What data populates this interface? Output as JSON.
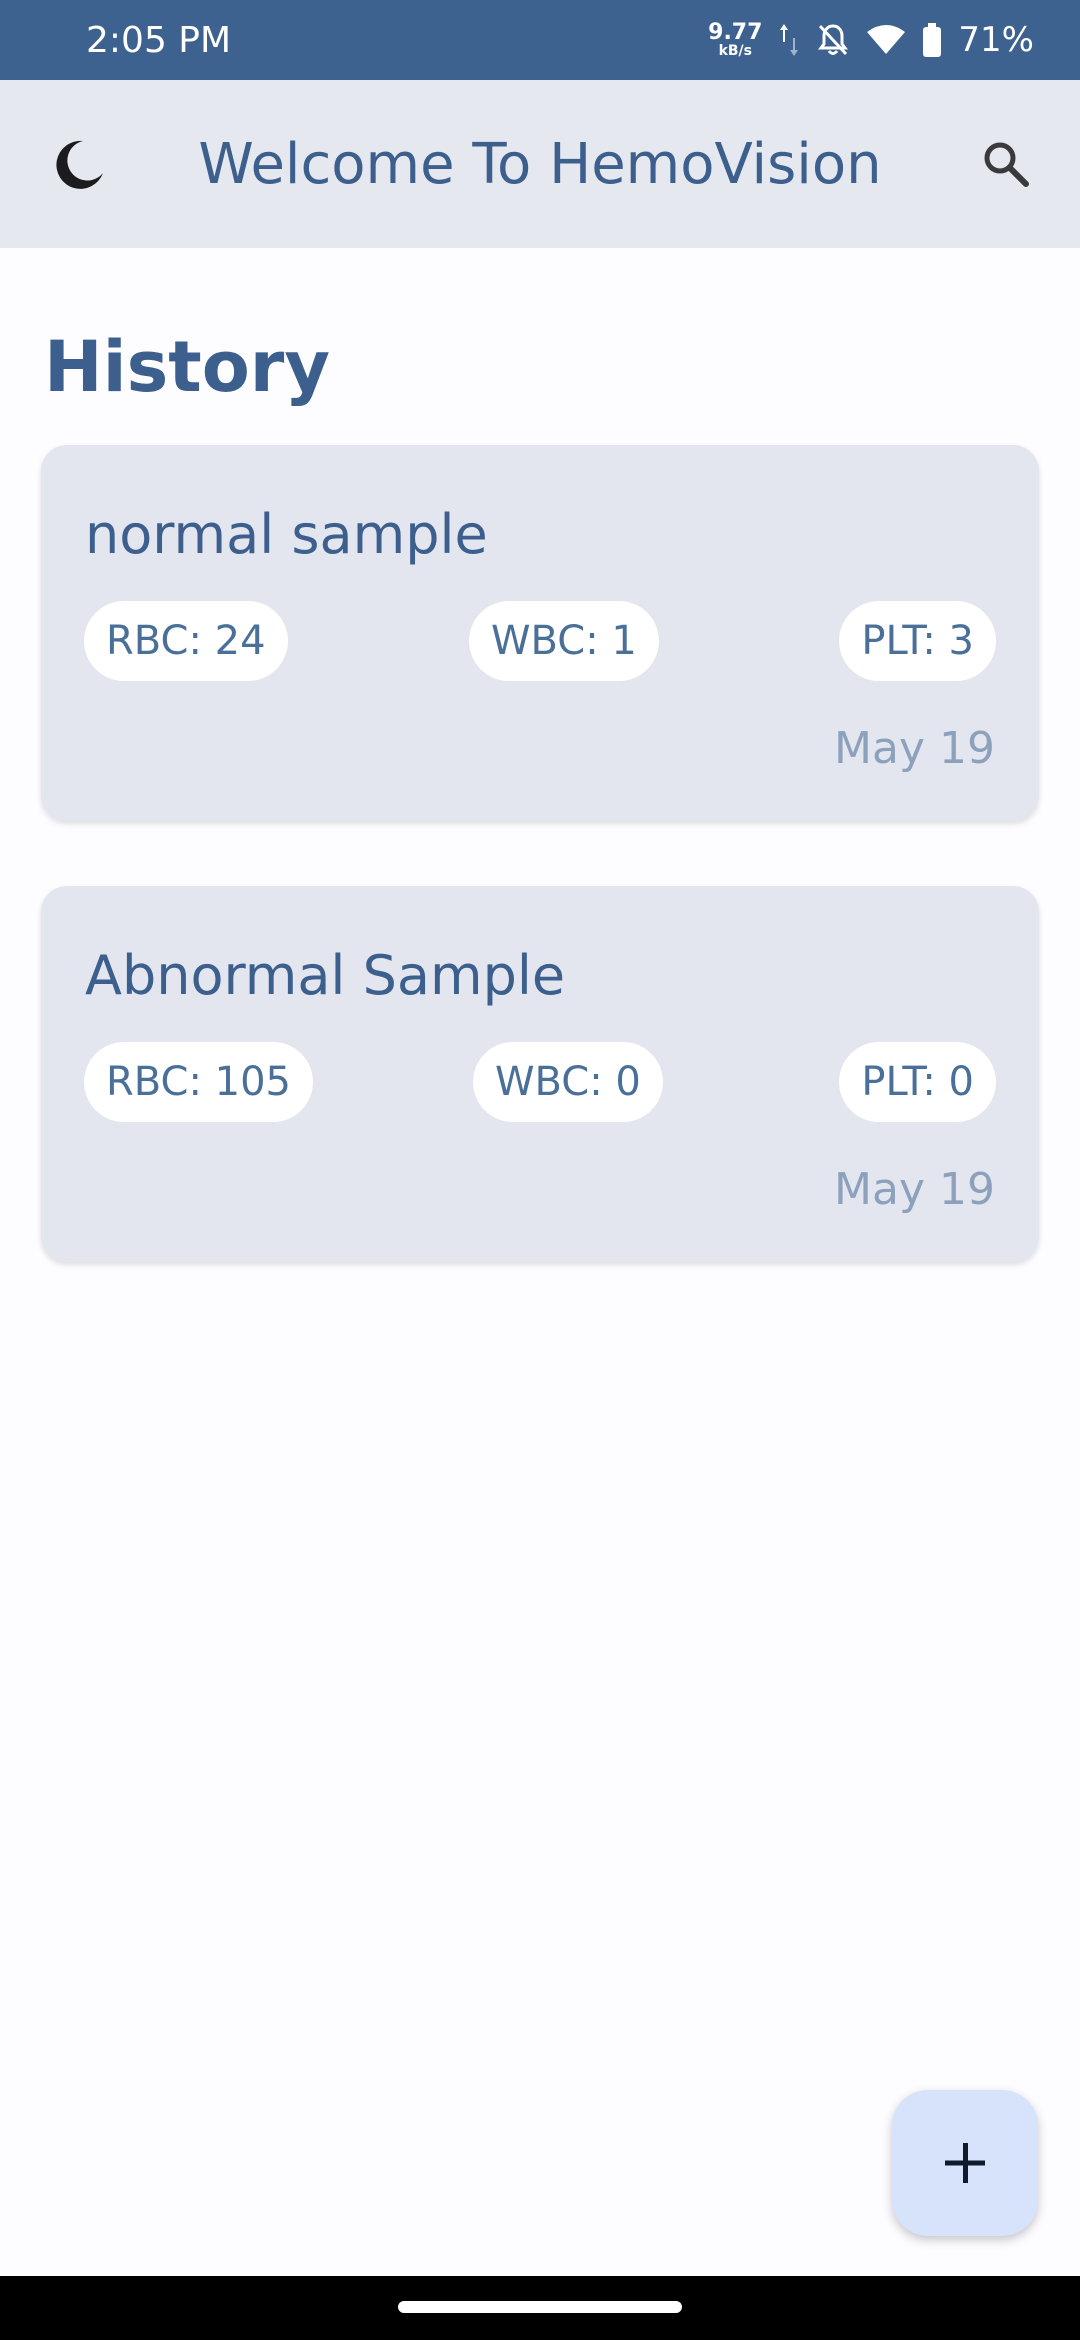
{
  "status_bar": {
    "time": "2:05 PM",
    "net_speed_value": "9.77",
    "net_speed_unit": "kB/s",
    "battery": "71%"
  },
  "app_bar": {
    "title": "Welcome To HemoVision"
  },
  "history": {
    "title": "History",
    "items": [
      {
        "name": "normal sample",
        "rbc": "RBC: 24",
        "wbc": "WBC: 1",
        "plt": "PLT: 3",
        "date": "May 19"
      },
      {
        "name": "Abnormal Sample",
        "rbc": "RBC: 105",
        "wbc": "WBC: 0",
        "plt": "PLT: 0",
        "date": "May 19"
      }
    ]
  },
  "icons": {
    "theme_toggle": "moon-icon",
    "search": "search-icon",
    "add": "plus-icon"
  },
  "colors": {
    "primary": "#3d5f8d",
    "status_bar": "#3d628f",
    "card_bg": "#e3e6ee",
    "fab_bg": "#d6e3fb"
  }
}
